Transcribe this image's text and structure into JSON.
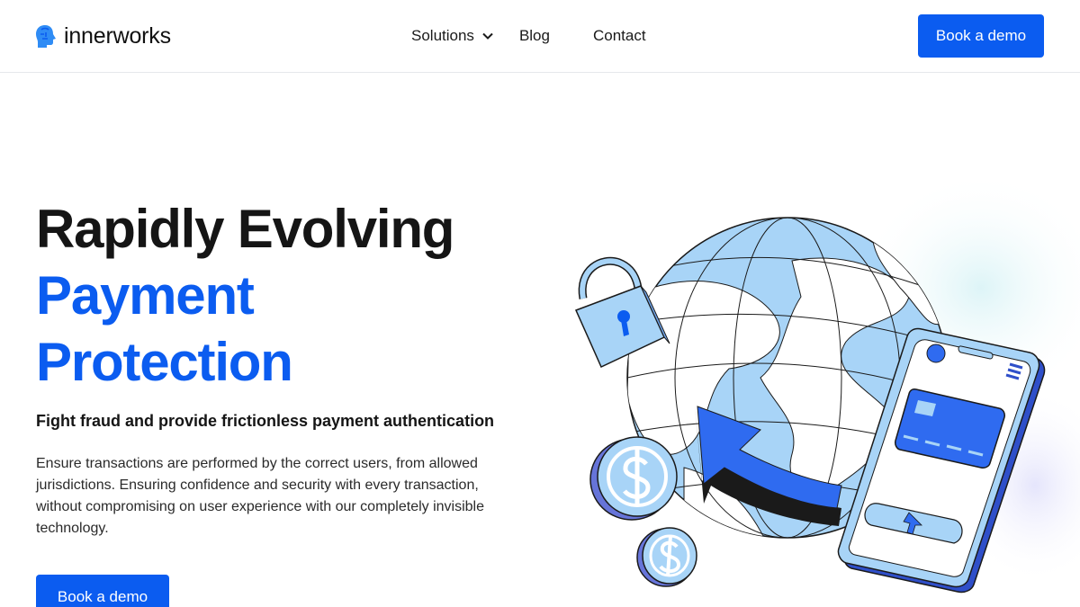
{
  "brand": {
    "name": "innerworks",
    "icon": "head-profile-icon"
  },
  "nav": {
    "items": [
      {
        "label": "Solutions",
        "icon": "chevron-down-icon"
      },
      {
        "label": "Blog"
      },
      {
        "label": "Contact"
      }
    ],
    "cta": "Book a demo"
  },
  "hero": {
    "title_line1": "Rapidly Evolving",
    "title_line2": "Payment",
    "title_line3": "Protection",
    "subtitle": "Fight fraud and provide frictionless payment authentication",
    "body": "Ensure transactions are performed by the correct users, from allowed jurisdictions. Ensuring confidence and security with every transaction, without compromising on user experience with our completely invisible technology.",
    "cta": "Book a demo"
  },
  "colors": {
    "accent": "#0b5cf0",
    "globe_fill": "#a8d4f7",
    "ocean": "#ffffff",
    "outline": "#1a1a1a"
  },
  "illustration": {
    "icons": [
      "globe-icon",
      "padlock-icon",
      "dollar-coin-icon",
      "phone-icon",
      "credit-card-icon",
      "arrow-icon",
      "user-avatar-icon",
      "menu-icon",
      "upload-arrow-icon"
    ]
  }
}
